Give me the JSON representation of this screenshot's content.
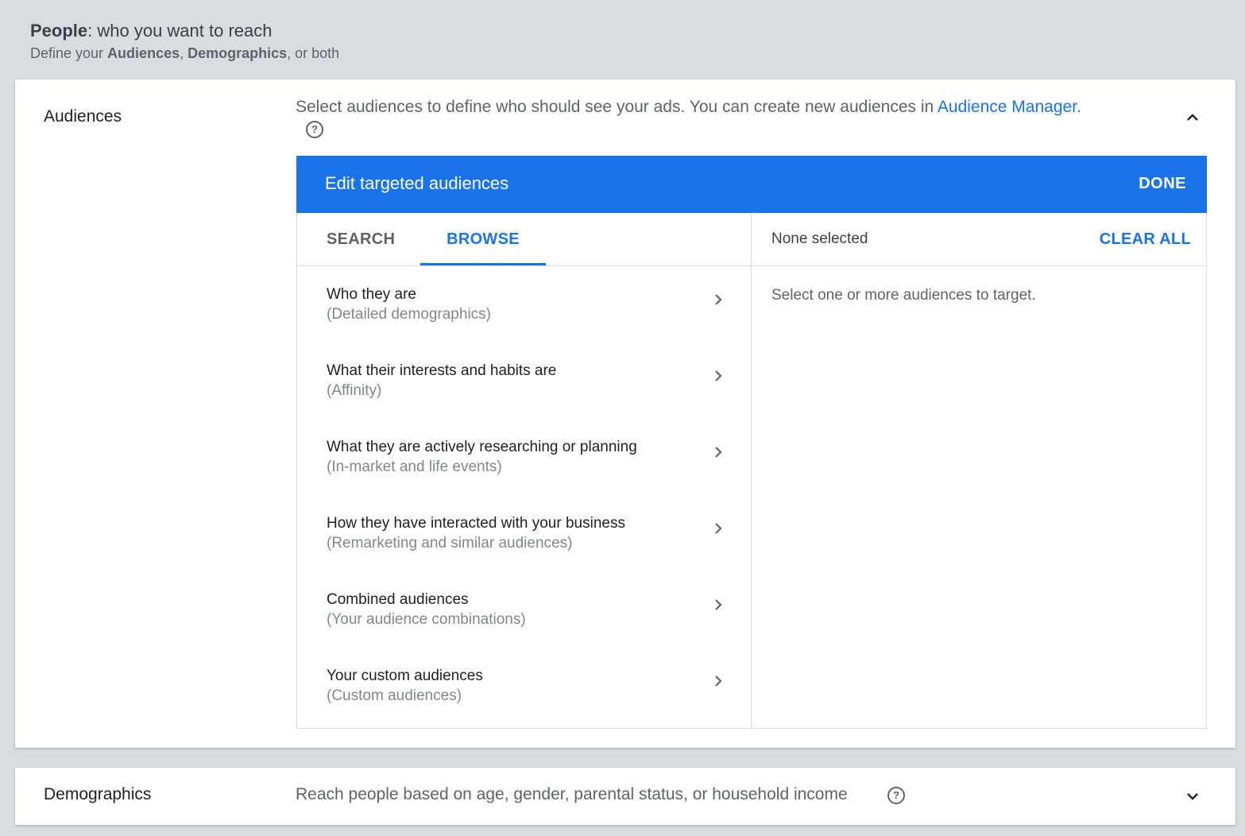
{
  "people": {
    "title_bold": "People",
    "title_rest": ": who you want to reach",
    "sub_prefix": "Define your ",
    "sub_audiences": "Audiences",
    "sub_sep": ", ",
    "sub_demographics": "Demographics",
    "sub_suffix": ", or both"
  },
  "audiences": {
    "label": "Audiences",
    "description": "Select audiences to define who should see your ads.  You can create new audiences in ",
    "manager_link": "Audience Manager",
    "description_end": ".",
    "help_glyph": "?",
    "editor": {
      "title": "Edit targeted audiences",
      "done_label": "DONE",
      "tabs": [
        {
          "label": "SEARCH",
          "active": false
        },
        {
          "label": "BROWSE",
          "active": true
        }
      ],
      "browse_items": [
        {
          "title": "Who they are",
          "subtitle": "(Detailed demographics)"
        },
        {
          "title": "What their interests and habits are",
          "subtitle": "(Affinity)"
        },
        {
          "title": "What they are actively researching or planning",
          "subtitle": "(In-market and life events)"
        },
        {
          "title": "How they have interacted with your business",
          "subtitle": "(Remarketing and similar audiences)"
        },
        {
          "title": "Combined audiences",
          "subtitle": "(Your audience combinations)"
        },
        {
          "title": "Your custom audiences",
          "subtitle": "(Custom audiences)"
        }
      ],
      "selection": {
        "status": "None selected",
        "clear_label": "CLEAR ALL",
        "empty_message": "Select one or more audiences to target."
      }
    }
  },
  "demographics": {
    "label": "Demographics",
    "description": "Reach people based on age, gender, parental status, or household income",
    "help_glyph": "?"
  },
  "icons": {
    "collapse": "chevron-up-icon",
    "expand": "chevron-down-icon",
    "item_arrow": "chevron-right-icon",
    "help": "help-circle-icon"
  },
  "colors": {
    "accent": "#1a73e8",
    "background": "#dadce0",
    "card": "#ffffff",
    "text_primary": "#202124",
    "text_secondary": "#5f6368"
  }
}
